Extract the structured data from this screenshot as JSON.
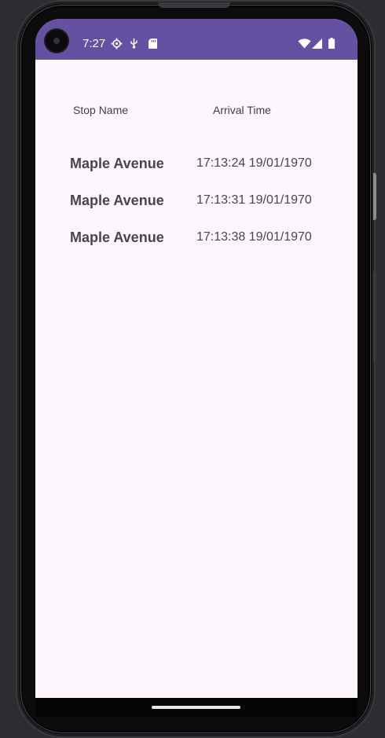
{
  "status_bar": {
    "time": "7:27",
    "color": "#6451a2",
    "icons_left": [
      "settings-gear-icon",
      "usb-debug-icon",
      "sd-card-icon"
    ],
    "icons_right": [
      "wifi-icon",
      "cell-signal-icon",
      "battery-icon"
    ]
  },
  "table": {
    "headers": {
      "stop_name": "Stop Name",
      "arrival_time": "Arrival Time"
    },
    "rows": [
      {
        "stop": "Maple Avenue",
        "arrival": "17:13:24 19/01/1970"
      },
      {
        "stop": "Maple Avenue",
        "arrival": "17:13:31 19/01/1970"
      },
      {
        "stop": "Maple Avenue",
        "arrival": "17:13:38 19/01/1970"
      }
    ]
  },
  "colors": {
    "background": "#fdf6fd",
    "text": "#46464d"
  }
}
